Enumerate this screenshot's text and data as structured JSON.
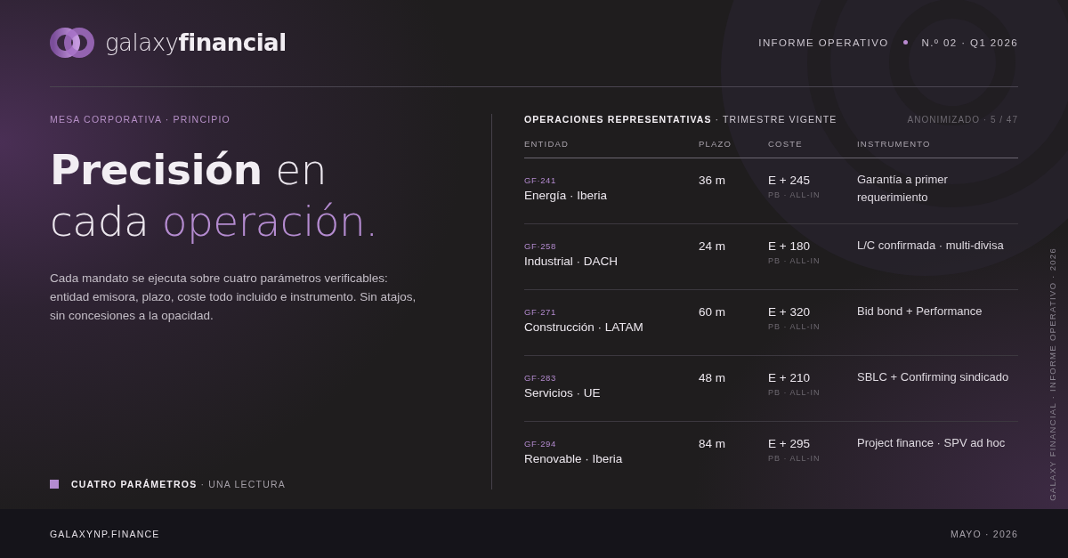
{
  "brand": {
    "light": "galaxy",
    "bold": "financial"
  },
  "header": {
    "report": "INFORME OPERATIVO",
    "issue": "N.º 02 · Q1 2026"
  },
  "side_label": "GALAXY FINANCIAL · INFORME OPERATIVO · 2026",
  "intro": {
    "eyebrow": "MESA CORPORATIVA · PRINCIPIO",
    "headline": [
      [
        {
          "text": "Precisión",
          "kind": "strong"
        },
        {
          "text": " en",
          "kind": "light"
        }
      ],
      [
        {
          "text": "cada",
          "kind": "light"
        },
        {
          "text": " operación.",
          "kind": "accent"
        }
      ]
    ],
    "body": "Cada mandato se ejecuta sobre cuatro parámetros verificables: entidad emisora, plazo, coste todo incluido e instrumento. Sin atajos, sin concesiones a la opacidad.",
    "note": "**CUATRO PARÁMETROS** · UNA LECTURA"
  },
  "table": {
    "title": "**OPERACIONES REPRESENTATIVAS** · TRIMESTRE VIGENTE",
    "counter": "ANONIMIZADO · 5 / 47",
    "columns": [
      "ENTIDAD",
      "PLAZO",
      "COSTE",
      "INSTRUMENTO"
    ],
    "rows": [
      {
        "code": "GF·241",
        "entity": "Energía · Iberia",
        "term": "36 m",
        "cost": "E + 245",
        "cost_note": "PB · ALL-IN",
        "instrument": "Garantía a primer requerimiento"
      },
      {
        "code": "GF·258",
        "entity": "Industrial · DACH",
        "term": "24 m",
        "cost": "E + 180",
        "cost_note": "PB · ALL-IN",
        "instrument": "L/C confirmada · multi-divisa"
      },
      {
        "code": "GF·271",
        "entity": "Construcción · LATAM",
        "term": "60 m",
        "cost": "E + 320",
        "cost_note": "PB · ALL-IN",
        "instrument": "Bid bond + Performance"
      },
      {
        "code": "GF·283",
        "entity": "Servicios · UE",
        "term": "48 m",
        "cost": "E + 210",
        "cost_note": "PB · ALL-IN",
        "instrument": "SBLC + Confirming sindicado"
      },
      {
        "code": "GF·294",
        "entity": "Renovable · Iberia",
        "term": "84 m",
        "cost": "E + 295",
        "cost_note": "PB · ALL-IN",
        "instrument": "Project finance · SPV ad hoc"
      }
    ]
  },
  "footer": {
    "site": "GALAXYNP.FINANCE",
    "date": "MAYO · 2026"
  }
}
